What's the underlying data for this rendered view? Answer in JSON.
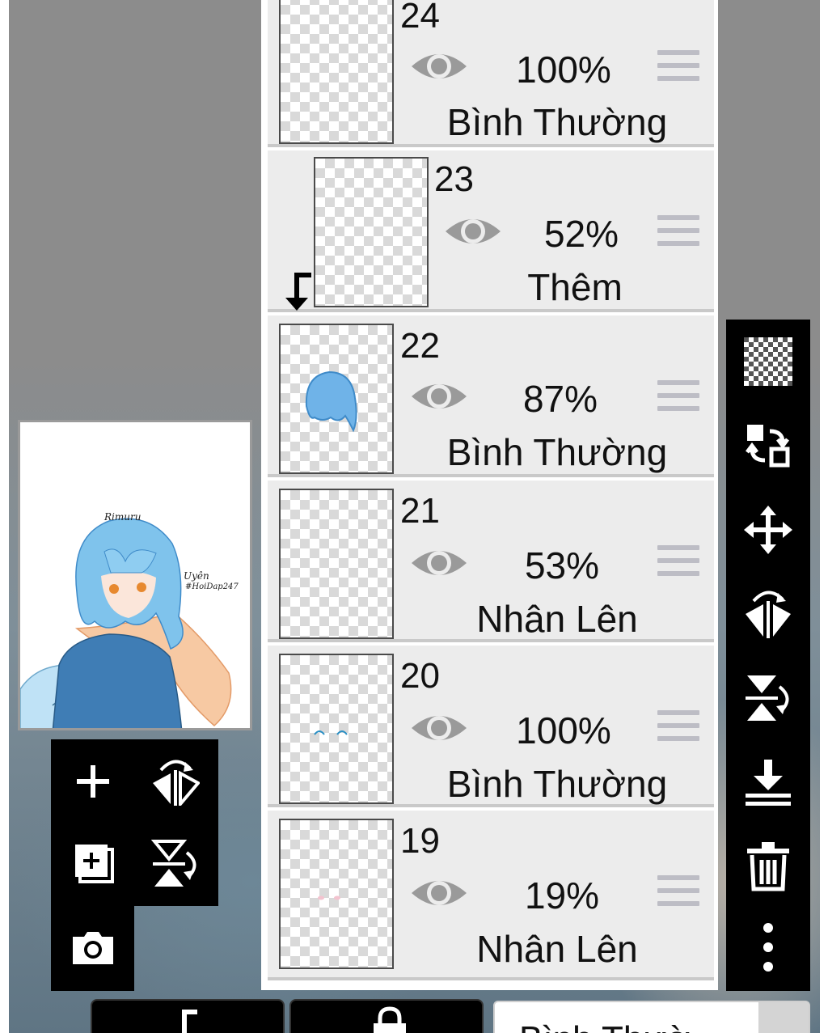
{
  "layers": [
    {
      "number": "24",
      "opacity": "100%",
      "mode": "Bình Thường",
      "visible": true,
      "clipped": false
    },
    {
      "number": "23",
      "opacity": "52%",
      "mode": "Thêm",
      "visible": true,
      "clipped": true
    },
    {
      "number": "22",
      "opacity": "87%",
      "mode": "Bình Thường",
      "visible": true,
      "clipped": false
    },
    {
      "number": "21",
      "opacity": "53%",
      "mode": "Nhân Lên",
      "visible": true,
      "clipped": false
    },
    {
      "number": "20",
      "opacity": "100%",
      "mode": "Bình Thường",
      "visible": true,
      "clipped": false
    },
    {
      "number": "19",
      "opacity": "19%",
      "mode": "Nhân Lên",
      "visible": true,
      "clipped": false
    }
  ],
  "navigator": {
    "title": "Rimuru",
    "signature_line1": "Uyên",
    "signature_line2": "#HoiDap247"
  },
  "right_toolbar": {
    "tools": [
      "transparency-icon",
      "swap-layer-icon",
      "move-icon",
      "flip-horizontal-icon",
      "flip-vertical-icon",
      "merge-down-icon",
      "trash-icon",
      "more-icon"
    ]
  },
  "left_toolbar": {
    "tools": [
      "add-layer-icon",
      "flip-canvas-horizontal-icon",
      "duplicate-layer-icon",
      "flip-canvas-vertical-icon",
      "camera-icon"
    ]
  },
  "bottom_bar": {
    "blend_mode_value": "Bình Thườ"
  },
  "colors": {
    "panel_bg": "#ececec",
    "toolbar_bg": "#000000",
    "icon_gray": "#9a9a9a"
  }
}
